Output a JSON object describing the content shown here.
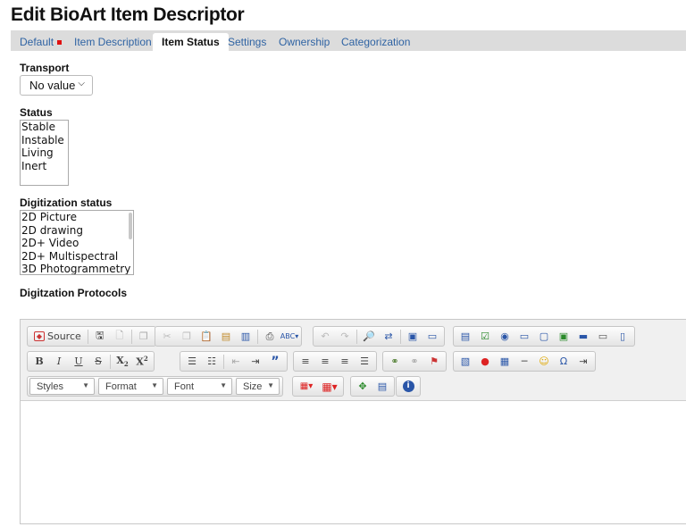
{
  "page": {
    "title": "Edit BioArt Item Descriptor"
  },
  "tabs": [
    {
      "label": "Default",
      "has_error": true
    },
    {
      "label": "Item Description"
    },
    {
      "label": "Item Status",
      "active": true
    },
    {
      "label": "Settings"
    },
    {
      "label": "Ownership"
    },
    {
      "label": "Categorization"
    }
  ],
  "transport": {
    "label": "Transport",
    "value": "No value"
  },
  "status": {
    "label": "Status",
    "options": [
      "Stable",
      "Instable",
      "Living",
      "Inert"
    ]
  },
  "digitization_status": {
    "label": "Digitization status",
    "options": [
      "2D Picture",
      "2D drawing",
      "2D+ Video",
      "2D+ Multispectral",
      "3D Photogrammetry"
    ]
  },
  "protocols": {
    "label": "Digitzation Protocols"
  },
  "editor": {
    "source_label": "Source",
    "styles_label": "Styles",
    "format_label": "Format",
    "font_label": "Font",
    "size_label": "Size"
  },
  "colors": {
    "tab_link": "#2f63a3",
    "error_dot": "#e01010",
    "tabbar_bg": "#dcdcdc"
  }
}
